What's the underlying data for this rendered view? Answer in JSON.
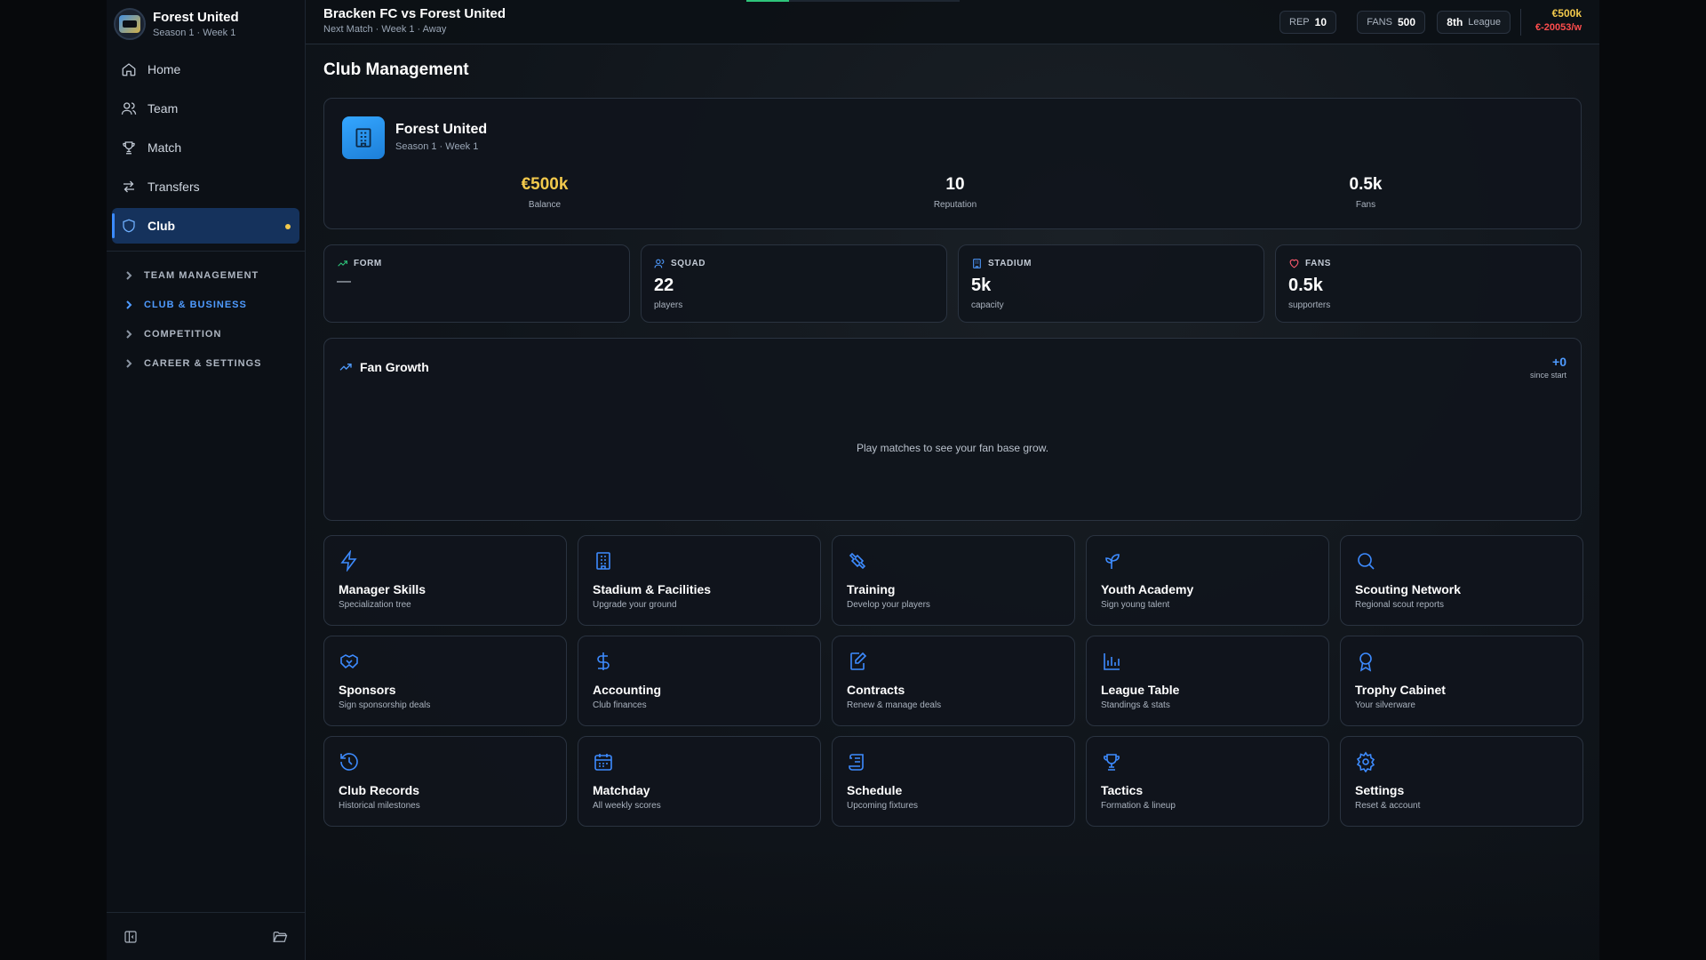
{
  "sidebar": {
    "club_name": "Forest United",
    "club_sub": "Season 1 · Week 1",
    "nav": [
      {
        "label": "Home"
      },
      {
        "label": "Team"
      },
      {
        "label": "Match"
      },
      {
        "label": "Transfers"
      },
      {
        "label": "Club"
      }
    ],
    "sections": [
      {
        "label": "TEAM MANAGEMENT"
      },
      {
        "label": "CLUB & BUSINESS"
      },
      {
        "label": "COMPETITION"
      },
      {
        "label": "CAREER & SETTINGS"
      }
    ],
    "active_nav": "Club",
    "active_section": "CLUB & BUSINESS"
  },
  "topbar": {
    "match_title": "Bracken FC vs Forest United",
    "match_sub": "Next Match · Week 1 · Away",
    "rep_label": "REP",
    "rep_value": "10",
    "fans_label": "FANS",
    "fans_value": "500",
    "league_position": "8th",
    "league_label": "League",
    "balance": "€500k",
    "wage": "€-20053/w"
  },
  "page": {
    "title": "Club Management"
  },
  "club_card": {
    "name": "Forest United",
    "sub": "Season 1 · Week 1",
    "stats": [
      {
        "value": "€500k",
        "label": "Balance"
      },
      {
        "value": "10",
        "label": "Reputation"
      },
      {
        "value": "0.5k",
        "label": "Fans"
      }
    ]
  },
  "mini_stats": {
    "form": {
      "label": "FORM",
      "value": "—"
    },
    "squad": {
      "label": "SQUAD",
      "value": "22",
      "unit": "players"
    },
    "stadium": {
      "label": "STADIUM",
      "value": "5k",
      "unit": "capacity"
    },
    "fans": {
      "label": "FANS",
      "value": "0.5k",
      "unit": "supporters"
    }
  },
  "fan_growth": {
    "title": "Fan Growth",
    "delta": "+0",
    "delta_label": "since start",
    "empty_message": "Play matches to see your fan base grow."
  },
  "tiles": [
    {
      "title": "Manager Skills",
      "sub": "Specialization tree",
      "icon": "lightning-icon"
    },
    {
      "title": "Stadium & Facilities",
      "sub": "Upgrade your ground",
      "icon": "building-icon"
    },
    {
      "title": "Training",
      "sub": "Develop your players",
      "icon": "dumbbell-icon"
    },
    {
      "title": "Youth Academy",
      "sub": "Sign young talent",
      "icon": "sprout-icon"
    },
    {
      "title": "Scouting Network",
      "sub": "Regional scout reports",
      "icon": "search-icon"
    },
    {
      "title": "Sponsors",
      "sub": "Sign sponsorship deals",
      "icon": "handshake-icon"
    },
    {
      "title": "Accounting",
      "sub": "Club finances",
      "icon": "dollar-icon"
    },
    {
      "title": "Contracts",
      "sub": "Renew & manage deals",
      "icon": "contract-icon"
    },
    {
      "title": "League Table",
      "sub": "Standings & stats",
      "icon": "bar-chart-icon"
    },
    {
      "title": "Trophy Cabinet",
      "sub": "Your silverware",
      "icon": "award-icon"
    },
    {
      "title": "Club Records",
      "sub": "Historical milestones",
      "icon": "history-icon"
    },
    {
      "title": "Matchday",
      "sub": "All weekly scores",
      "icon": "calendar-icon"
    },
    {
      "title": "Schedule",
      "sub": "Upcoming fixtures",
      "icon": "scroll-icon"
    },
    {
      "title": "Tactics",
      "sub": "Formation & lineup",
      "icon": "trophy-icon"
    },
    {
      "title": "Settings",
      "sub": "Reset & account",
      "icon": "gear-icon"
    }
  ],
  "colors": {
    "accent": "#3b8bff",
    "gold": "#f2c94c",
    "negative": "#ff4d4d",
    "positive": "#2ec47a"
  }
}
